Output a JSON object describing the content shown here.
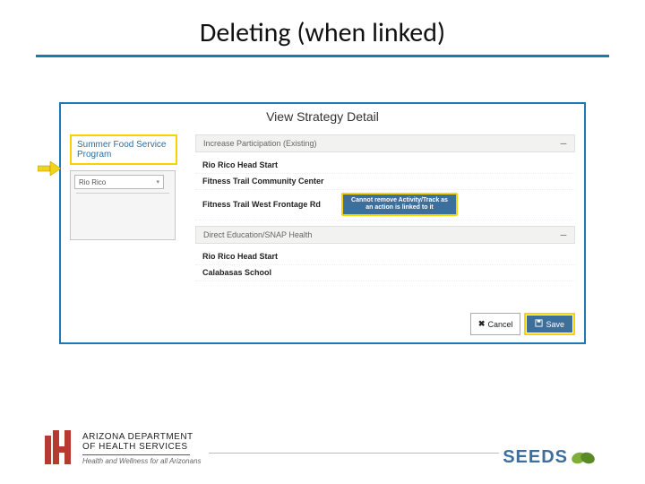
{
  "slide": {
    "title": "Deleting (when linked)"
  },
  "panel": {
    "title": "View Strategy Detail",
    "sidebar": {
      "header": "Summer Food Service Program",
      "search_value": "Rio Rico"
    },
    "sections": [
      {
        "label": "Increase Participation (Existing)",
        "rows": [
          "Rio Rico Head Start",
          "Fitness Trail Community Center",
          "Fitness Trail West Frontage Rd"
        ]
      },
      {
        "label": "Direct Education/SNAP Health",
        "rows": [
          "Rio Rico Head Start",
          "Calabasas School"
        ]
      }
    ],
    "tooltip": "Cannot remove Activity/Track as an action is linked to it",
    "buttons": {
      "cancel": "Cancel",
      "save": "Save"
    }
  },
  "footer": {
    "adhs_line1": "ARIZONA DEPARTMENT",
    "adhs_line2": "OF HEALTH SERVICES",
    "adhs_tagline": "Health and Wellness for all Arizonans",
    "seeds": "SEEDS"
  }
}
